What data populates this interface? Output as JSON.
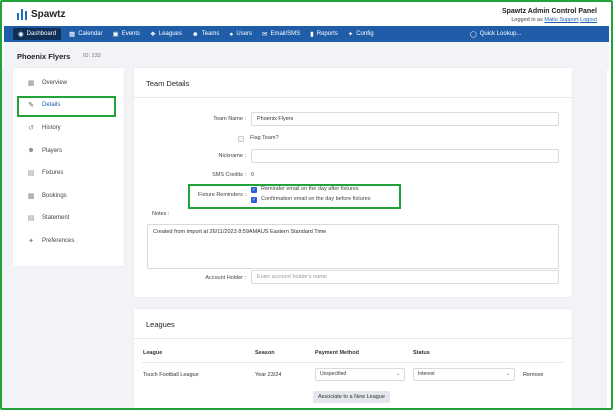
{
  "brand": {
    "name": "Spawtz"
  },
  "admin": {
    "title": "Spawtz Admin Control Panel",
    "logged_in_prefix": "Logged in as",
    "user": "Matio Support",
    "logout": "Logout"
  },
  "nav": {
    "items": [
      {
        "label": "Dashboard",
        "icon": "dashboard-icon"
      },
      {
        "label": "Calendar",
        "icon": "calendar-icon"
      },
      {
        "label": "Events",
        "icon": "events-icon"
      },
      {
        "label": "Leagues",
        "icon": "leagues-icon"
      },
      {
        "label": "Teams",
        "icon": "teams-icon"
      },
      {
        "label": "Users",
        "icon": "users-icon"
      },
      {
        "label": "Email/SMS",
        "icon": "email-icon"
      },
      {
        "label": "Reports",
        "icon": "reports-icon"
      },
      {
        "label": "Config",
        "icon": "wrench-icon"
      }
    ],
    "quick_lookup": "Quick Lookup..."
  },
  "page": {
    "team_name": "Phoenix Flyers",
    "team_id": "ID: 133"
  },
  "sidebar": {
    "items": [
      {
        "label": "Overview",
        "icon": "grid-icon"
      },
      {
        "label": "Details",
        "icon": "pencil-icon"
      },
      {
        "label": "History",
        "icon": "history-icon"
      },
      {
        "label": "Players",
        "icon": "players-icon"
      },
      {
        "label": "Fixtures",
        "icon": "fixtures-icon"
      },
      {
        "label": "Bookings",
        "icon": "bookings-icon"
      },
      {
        "label": "Statement",
        "icon": "statement-icon"
      },
      {
        "label": "Preferences",
        "icon": "wrench-icon"
      }
    ]
  },
  "details": {
    "title": "Team Details",
    "team_name_label": "Team Name :",
    "team_name_value": "Phoenix Flyers",
    "flag_team_label": "Flag Team?",
    "nickname_label": "Nickname :",
    "nickname_value": "",
    "sms_credits_label": "SMS Credits :",
    "sms_credits_value": "0",
    "fixture_reminders_label": "Fixture Reminders :",
    "reminder_after": "Reminder email on the day after fixtures",
    "reminder_before": "Confirmation email on the day before fixtures",
    "notes_label": "Notes :",
    "notes_value": "Created from import at 26/11/2023 8:59AMAUS Eastern Standard Time",
    "account_holder_label": "Account Holder :",
    "account_holder_placeholder": "Enter account holder's name"
  },
  "leagues": {
    "title": "Leagues",
    "headers": [
      "League",
      "Season",
      "Payment Method",
      "Status"
    ],
    "rows": [
      {
        "league": "Touch Football League",
        "season": "Year 23/24",
        "payment": "Unspecified",
        "status": "Interest",
        "action": "Remove"
      }
    ],
    "associate_button": "Associate to a New League"
  }
}
